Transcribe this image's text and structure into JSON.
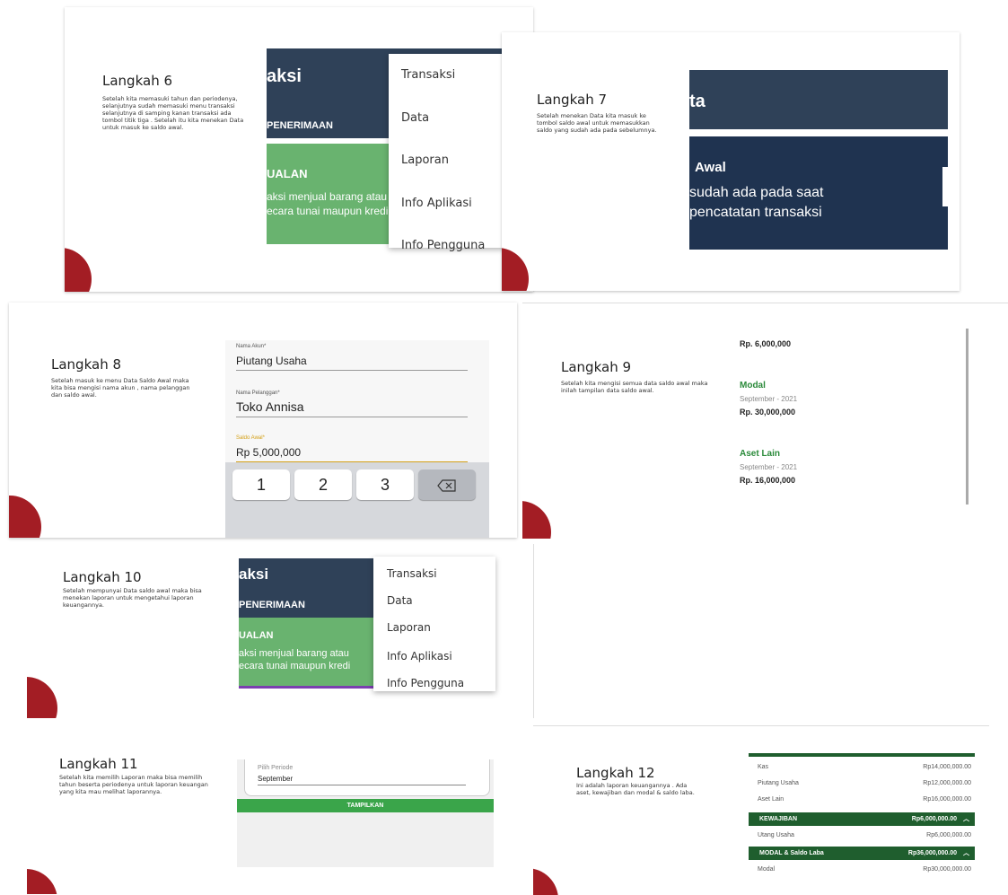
{
  "step6": {
    "title": "Langkah 6",
    "desc": "Setelah kita memasuki tahun dan periodenya, selanjutnya sudah memasuki menu transaksi selanjutnya di samping kanan transaksi ada tombol titik tiga . Setelah itu kita menekan Data untuk masuk ke saldo awal.",
    "header_title": "aksi",
    "tab_label": "PENERIMAAN",
    "card_title": "UALAN",
    "card_text_1": "aksi menjual barang atau",
    "card_text_2": "ecara tunai maupun kredi",
    "menu": [
      "Transaksi",
      "Data",
      "Laporan",
      "Info Aplikasi",
      "Info Pengguna"
    ]
  },
  "step7": {
    "title": "Langkah 7",
    "desc": "Setelah menekan Data kita masuk ke tombol saldo awal untuk memasukkan saldo yang sudah ada pada sebelumnya.",
    "header_title": "ta",
    "card_title": "Awal",
    "card_text_1": "sudah ada pada saat",
    "card_text_2": "pencatatan transaksi"
  },
  "step8": {
    "title": "Langkah 8",
    "desc": "Setelah masuk ke menu Data Saldo Awal maka kita bisa mengisi nama akun , nama pelanggan dan saldo awal.",
    "account_label": "Nama Akun*",
    "account_value": "Piutang Usaha",
    "customer_label": "Nama Pelanggan*",
    "customer_value": "Toko Annisa",
    "saldo_label": "Saldo Awal*",
    "saldo_value": "Rp 5,000,000",
    "keys": [
      "1",
      "2",
      "3"
    ],
    "backspace_icon": "backspace-icon"
  },
  "step9": {
    "title": "Langkah 9",
    "desc": "Setelah kita mengisi semua data saldo awal maka inilah tampilan data saldo awal.",
    "top_amount": "Rp. 6,000,000",
    "items": [
      {
        "name": "Modal",
        "period": "September - 2021",
        "amount": "Rp. 30,000,000"
      },
      {
        "name": "Aset Lain",
        "period": "September - 2021",
        "amount": "Rp. 16,000,000"
      }
    ]
  },
  "step10": {
    "title": "Langkah 10",
    "desc": "Setelah mempunyai Data saldo awal maka bisa menekan laporan untuk mengetahui laporan keuangannya.",
    "header_title": "aksi",
    "tab_label": "PENERIMAAN",
    "card_title": "UALAN",
    "card_text_1": "aksi menjual barang atau",
    "card_text_2": "ecara tunai maupun kredi",
    "menu": [
      "Transaksi",
      "Data",
      "Laporan",
      "Info Aplikasi",
      "Info Pengguna"
    ]
  },
  "step11": {
    "title": "Langkah 11",
    "desc": "Setelah kita memilih Laporan maka bisa memilih tahun beserta periodenya untuk laporan keuangan yang kita mau melihat laporannya.",
    "period_label": "Pilih Periode",
    "period_value": "September",
    "show_button": "TAMPILKAN"
  },
  "step12": {
    "title": "Langkah 12",
    "desc": "Ini adalah laporan keuangannya . Ada aset, kewajiban dan modal & saldo laba.",
    "rows": [
      {
        "label": "Kas",
        "value": "Rp14,000,000.00"
      },
      {
        "label": "Piutang Usaha",
        "value": "Rp12,000,000.00"
      },
      {
        "label": "Aset Lain",
        "value": "Rp16,000,000.00"
      }
    ],
    "section1": {
      "label": "KEWAJIBAN",
      "value": "Rp6,000,000.00"
    },
    "row_kewajiban": {
      "label": "Utang Usaha",
      "value": "Rp6,000,000.00"
    },
    "section2": {
      "label": "MODAL & Saldo Laba",
      "value": "Rp36,000,000.00"
    },
    "row_modal": {
      "label": "Modal",
      "value": "Rp30,000,000.00"
    },
    "colors": {
      "dark_green": "#1f5e2e",
      "navy": "#2f4158",
      "green": "#69b36f",
      "red": "#a31d24"
    }
  }
}
